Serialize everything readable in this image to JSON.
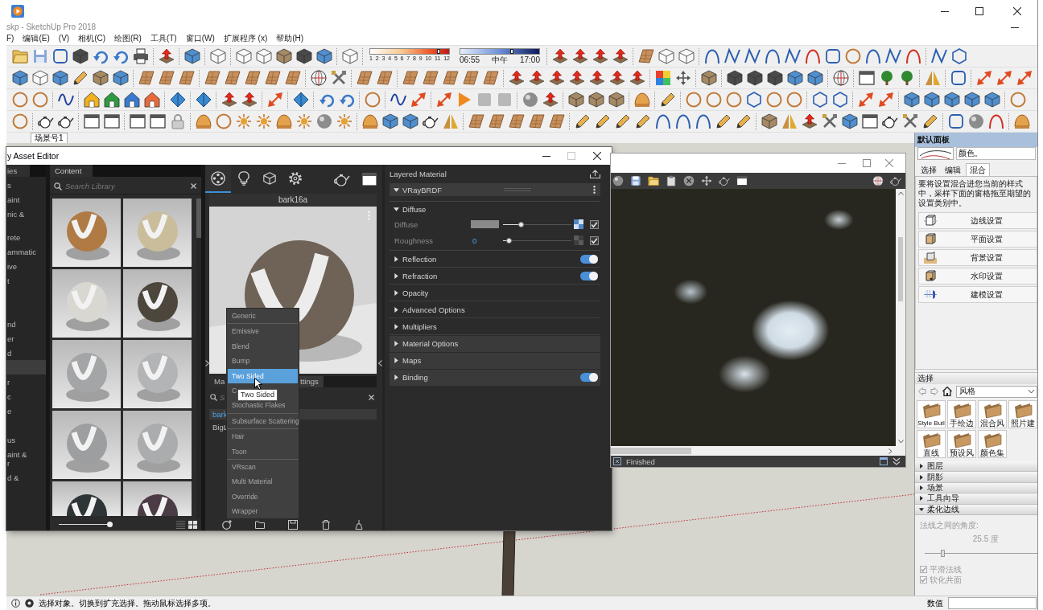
{
  "window": {
    "title": "skp - SketchUp Pro 2018"
  },
  "menu": [
    {
      "label": "F)"
    },
    {
      "label": "编辑(E)"
    },
    {
      "label": "(V)"
    },
    {
      "label": "相机(C)"
    },
    {
      "label": "绘图(R)"
    },
    {
      "label": "工具(T)"
    },
    {
      "label": "窗口(W)"
    },
    {
      "label": "扩展程序 (x)"
    },
    {
      "label": "帮助(H)"
    }
  ],
  "shadow_settings": {
    "month_slider": {
      "labels": [
        "1",
        "2",
        "3",
        "4",
        "5",
        "6",
        "7",
        "8",
        "9",
        "10",
        "11",
        "12"
      ],
      "level": 0.88
    },
    "time_slider": {
      "labels": [
        "06:55",
        "中午",
        "17:00"
      ],
      "level": 0.66
    }
  },
  "scene_tabs": [
    {
      "label": "场景号1",
      "selected": true
    }
  ],
  "asset_editor": {
    "title": "y Asset Editor",
    "categories": {
      "header": "ies",
      "items": [
        {
          "label": "s",
          "selected": false
        },
        {
          "label": "aint",
          "selected": false
        },
        {
          "label": "nic &",
          "selected": false
        },
        {
          "label": "rete",
          "selected": false
        },
        {
          "label": "ammatic",
          "selected": false
        },
        {
          "label": "ive",
          "selected": false
        },
        {
          "label": "t",
          "selected": false
        },
        {
          "label": "nd",
          "selected": false
        },
        {
          "label": "er",
          "selected": false
        },
        {
          "label": "d",
          "selected": false
        },
        {
          "selected": true
        },
        {
          "label": "r",
          "selected": false
        },
        {
          "label": "c",
          "selected": false
        },
        {
          "label": "e",
          "selected": false
        },
        {
          "label": "us",
          "selected": false
        },
        {
          "label": "aint &\nr",
          "selected": false
        },
        {
          "label": "d &",
          "selected": false
        }
      ]
    },
    "content": {
      "header": "Content",
      "search": {
        "placeholder": "Search Library"
      },
      "thumbnails": [
        {
          "color": "#b07a45"
        },
        {
          "color": "#c9bd9c"
        },
        {
          "color": "#d9d7d1"
        },
        {
          "color": "#4d463d"
        },
        {
          "color": "#a3a5a7"
        },
        {
          "color": "#b2b4b6"
        },
        {
          "color": "#9c9ea0"
        },
        {
          "color": "#aaacae"
        },
        {
          "color": "#2d3537"
        },
        {
          "color": "#4b3b45"
        }
      ],
      "size_slider": {
        "level": 1
      },
      "view_modes": [
        {
          "kind": "list",
          "selected": false
        },
        {
          "kind": "grid",
          "selected": true
        }
      ]
    },
    "preview": {
      "tabs": [
        {
          "kind": "material",
          "selected": true
        },
        {
          "kind": "light",
          "selected": false
        },
        {
          "kind": "geometry",
          "selected": false
        },
        {
          "kind": "settings",
          "selected": false
        }
      ],
      "title": "bark16a",
      "list_tabs": [
        {
          "label": "Ma"
        },
        {
          "label": "ttings"
        }
      ],
      "search": {
        "placeholder": "S"
      },
      "items": [
        {
          "label": "bark",
          "selected": true
        },
        {
          "label": "BigL",
          "selected": false
        }
      ]
    },
    "type_menu": {
      "groups": [
        {
          "items": [
            {
              "label": "Generic",
              "selected": false
            }
          ]
        },
        {
          "items": [
            {
              "label": "Emissive",
              "selected": false
            },
            {
              "label": "Blend",
              "selected": false
            },
            {
              "label": "Bump",
              "selected": false
            },
            {
              "label": "Two Sided",
              "selected": true
            },
            {
              "label": "C",
              "selected": false
            },
            {
              "label": "Stochastic Flakes",
              "selected": false
            }
          ]
        },
        {
          "items": [
            {
              "label": "Subsurface Scattering",
              "selected": false
            }
          ]
        },
        {
          "items": [
            {
              "label": "Hair",
              "selected": false
            },
            {
              "label": "Toon",
              "selected": false
            }
          ]
        },
        {
          "items": [
            {
              "label": "VRscan",
              "selected": false
            },
            {
              "label": "Multi Material",
              "selected": false
            },
            {
              "label": "Override",
              "selected": false
            },
            {
              "label": "Wrapper",
              "selected": false
            }
          ]
        }
      ]
    },
    "tooltip": "Two Sided",
    "settings": {
      "title": "Layered Material",
      "layer": {
        "label": "VRayBRDF",
        "expanded": true
      },
      "group": {
        "label": "Diffuse",
        "expanded": true
      },
      "params": [
        {
          "kind": "color",
          "label": "Diffuse",
          "level": 0.24,
          "has_texture": true,
          "checked": true
        },
        {
          "kind": "number",
          "label": "Roughness",
          "value": "0",
          "level": 0.05,
          "has_texture": false,
          "checked": true
        }
      ],
      "sections": [
        {
          "label": "Reflection",
          "kind": "toggle",
          "on": true,
          "expanded": false,
          "highlighted": false
        },
        {
          "label": "Refraction",
          "kind": "toggle",
          "on": true,
          "expanded": false,
          "highlighted": false
        },
        {
          "label": "Opacity",
          "kind": "plain",
          "expanded": false,
          "highlighted": false
        },
        {
          "label": "Advanced Options",
          "kind": "plain",
          "expanded": false,
          "highlighted": false
        },
        {
          "label": "Multipliers",
          "kind": "plain",
          "expanded": false,
          "highlighted": false
        },
        {
          "label": "Material Options",
          "kind": "plain",
          "expanded": false,
          "highlighted": true
        },
        {
          "label": "Maps",
          "kind": "plain",
          "expanded": false,
          "highlighted": true
        },
        {
          "label": "Binding",
          "kind": "toggle",
          "on": true,
          "expanded": false,
          "highlighted": true
        }
      ]
    }
  },
  "render_window": {
    "status": "Finished"
  },
  "tray": {
    "title": "默认面板",
    "style_description": "颜色。",
    "tabs": [
      {
        "label": "选择",
        "selected": false
      },
      {
        "label": "编辑",
        "selected": false
      },
      {
        "label": "混合",
        "selected": true
      }
    ],
    "instructions": "要将设置混合进您当前的样式中，采样下面的窗格拖至期望的设置类别中。",
    "targets": [
      {
        "kind": "edge",
        "label": "边线设置"
      },
      {
        "kind": "face",
        "label": "平面设置"
      },
      {
        "kind": "background",
        "label": "背景设置"
      },
      {
        "kind": "watermark",
        "label": "水印设置"
      },
      {
        "kind": "modeling",
        "label": "建模设置"
      }
    ],
    "browser": {
      "header": "选择",
      "collection": "风格",
      "folders": [
        {
          "label": "Style Buil"
        },
        {
          "label": "手绘边"
        },
        {
          "label": "混合风"
        },
        {
          "label": "照片建"
        },
        {
          "label": "直线"
        },
        {
          "label": "预设风"
        },
        {
          "label": "颜色集"
        }
      ]
    },
    "sections": [
      {
        "label": "图层",
        "expanded": false
      },
      {
        "label": "阴影",
        "expanded": false
      },
      {
        "label": "场景",
        "expanded": false
      },
      {
        "label": "工具向导",
        "expanded": false
      },
      {
        "label": "柔化边线",
        "expanded": true
      }
    ],
    "soften": {
      "label": "法线之间的角度:",
      "value": "25.5 度",
      "level": 0.15,
      "options": [
        {
          "label": "平滑法线",
          "checked": true
        },
        {
          "label": "软化共面",
          "checked": true
        }
      ]
    }
  },
  "status_bar": {
    "hint": "选择对象。切换到扩充选择。拖动鼠标选择多项。",
    "measurements_label": "数值"
  }
}
